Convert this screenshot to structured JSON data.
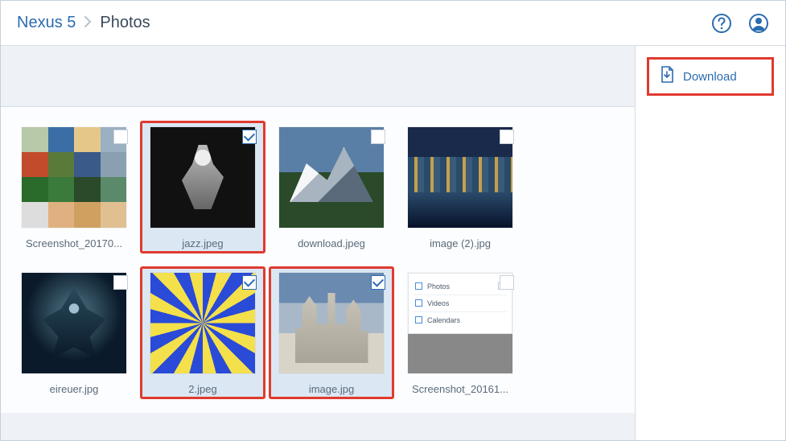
{
  "breadcrumb": {
    "root": "Nexus 5",
    "current": "Photos"
  },
  "sidebar": {
    "download_label": "Download"
  },
  "files": [
    {
      "name": "Screenshot_20170...",
      "selected": false,
      "highlight": false,
      "art": "collage"
    },
    {
      "name": "jazz.jpeg",
      "selected": true,
      "highlight": true,
      "art": "jazz"
    },
    {
      "name": "download.jpeg",
      "selected": false,
      "highlight": false,
      "art": "mountain"
    },
    {
      "name": "image (2).jpg",
      "selected": false,
      "highlight": false,
      "art": "kremlin"
    },
    {
      "name": "eireuer.jpg",
      "selected": false,
      "highlight": false,
      "art": "dark"
    },
    {
      "name": "2.jpeg",
      "selected": true,
      "highlight": true,
      "art": "spiral"
    },
    {
      "name": "image.jpg",
      "selected": true,
      "highlight": true,
      "art": "castle"
    },
    {
      "name": "Screenshot_20161...",
      "selected": false,
      "highlight": false,
      "art": "menu"
    }
  ],
  "menu_thumb": {
    "row1": "Photos",
    "row2": "Videos",
    "row3": "Calendars"
  }
}
